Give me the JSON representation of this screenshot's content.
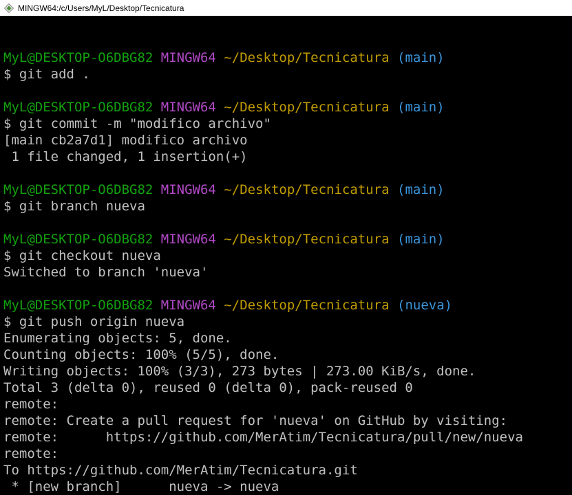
{
  "window": {
    "title": "MINGW64:/c/Users/MyL/Desktop/Tecnicatura"
  },
  "colors": {
    "user": "#13a10e",
    "system": "#b148c6",
    "path": "#c19c00",
    "branch": "#3a96dd",
    "output": "#c0c0c0",
    "background": "#000000"
  },
  "icons": {
    "app": "git-diamond-icon"
  },
  "terminal": {
    "lines": [
      "",
      {
        "user": "MyL@DESKTOP-O6DBG82",
        "sys": "MINGW64",
        "path": "~/Desktop/Tecnicatura",
        "branch": "(main)"
      },
      "$ git add .",
      "",
      {
        "user": "MyL@DESKTOP-O6DBG82",
        "sys": "MINGW64",
        "path": "~/Desktop/Tecnicatura",
        "branch": "(main)"
      },
      "$ git commit -m \"modifico archivo\"",
      "[main cb2a7d1] modifico archivo",
      " 1 file changed, 1 insertion(+)",
      "",
      {
        "user": "MyL@DESKTOP-O6DBG82",
        "sys": "MINGW64",
        "path": "~/Desktop/Tecnicatura",
        "branch": "(main)"
      },
      "$ git branch nueva",
      "",
      {
        "user": "MyL@DESKTOP-O6DBG82",
        "sys": "MINGW64",
        "path": "~/Desktop/Tecnicatura",
        "branch": "(main)"
      },
      "$ git checkout nueva",
      "Switched to branch 'nueva'",
      "",
      {
        "user": "MyL@DESKTOP-O6DBG82",
        "sys": "MINGW64",
        "path": "~/Desktop/Tecnicatura",
        "branch": "(nueva)"
      },
      "$ git push origin nueva",
      "Enumerating objects: 5, done.",
      "Counting objects: 100% (5/5), done.",
      "Writing objects: 100% (3/3), 273 bytes | 273.00 KiB/s, done.",
      "Total 3 (delta 0), reused 0 (delta 0), pack-reused 0",
      "remote:",
      "remote: Create a pull request for 'nueva' on GitHub by visiting:",
      "remote:      https://github.com/MerAtim/Tecnicatura/pull/new/nueva",
      "remote:",
      "To https://github.com/MerAtim/Tecnicatura.git",
      " * [new branch]      nueva -> nueva"
    ]
  }
}
